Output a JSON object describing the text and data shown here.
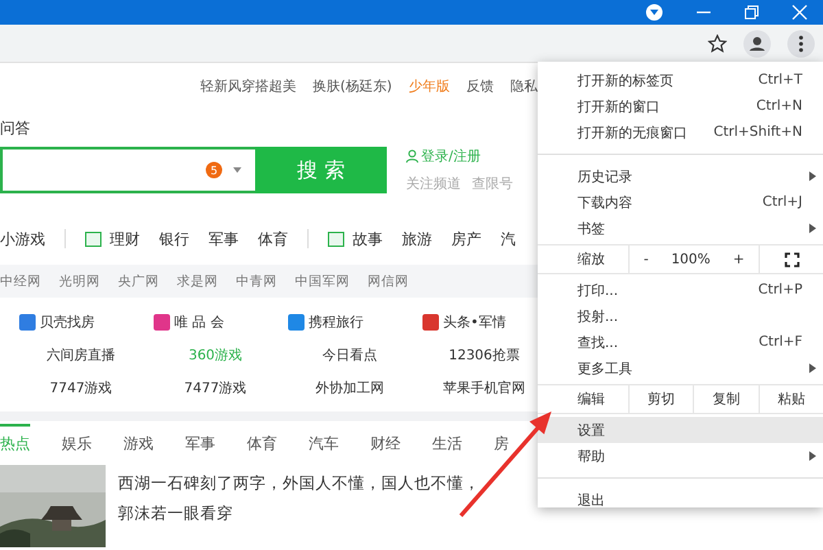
{
  "top_links": [
    {
      "label": "轻新风穿搭超美",
      "highlight": false
    },
    {
      "label": "换肤(杨廷东)",
      "highlight": false
    },
    {
      "label": "少年版",
      "highlight": true
    },
    {
      "label": "反馈",
      "highlight": false
    },
    {
      "label": "隐私",
      "highlight": false
    }
  ],
  "search": {
    "label": "问答",
    "badge": "5",
    "button": "搜 索"
  },
  "account": {
    "login": "登录/注册",
    "follow": "关注频道",
    "check": "查限号"
  },
  "nav": [
    {
      "kind": "text",
      "label": "小游戏"
    },
    {
      "kind": "divider"
    },
    {
      "kind": "icon",
      "label": "理财"
    },
    {
      "kind": "text",
      "label": "银行"
    },
    {
      "kind": "text",
      "label": "军事"
    },
    {
      "kind": "text",
      "label": "体育"
    },
    {
      "kind": "divider"
    },
    {
      "kind": "icon",
      "label": "故事"
    },
    {
      "kind": "text",
      "label": "旅游"
    },
    {
      "kind": "text",
      "label": "房产"
    },
    {
      "kind": "text",
      "label": "汽"
    }
  ],
  "media_links": [
    "中经网",
    "光明网",
    "央广网",
    "求是网",
    "中青网",
    "中国军网",
    "网信网"
  ],
  "site_grid": [
    {
      "title": "贝壳找房",
      "color": "#2f7de1",
      "links": [
        {
          "label": "六间房直播",
          "highlight": false
        },
        {
          "label": "7747游戏",
          "highlight": false
        }
      ]
    },
    {
      "title": "唯 品 会",
      "color": "#e0358a",
      "links": [
        {
          "label": "360游戏",
          "highlight": true
        },
        {
          "label": "7477游戏",
          "highlight": false
        }
      ]
    },
    {
      "title": "携程旅行",
      "color": "#1f88e5",
      "links": [
        {
          "label": "今日看点",
          "highlight": false
        },
        {
          "label": "外协加工网",
          "highlight": false
        }
      ]
    },
    {
      "title": "头条•军情",
      "color": "#d9362e",
      "links": [
        {
          "label": "12306抢票",
          "highlight": false
        },
        {
          "label": "苹果手机官网",
          "highlight": false
        }
      ]
    }
  ],
  "news_tabs": [
    {
      "label": "热点",
      "selected": true
    },
    {
      "label": "娱乐",
      "selected": false
    },
    {
      "label": "游戏",
      "selected": false
    },
    {
      "label": "军事",
      "selected": false
    },
    {
      "label": "体育",
      "selected": false
    },
    {
      "label": "汽车",
      "selected": false
    },
    {
      "label": "财经",
      "selected": false
    },
    {
      "label": "生活",
      "selected": false
    },
    {
      "label": "房",
      "selected": false
    }
  ],
  "news": [
    {
      "headline": "西湖一石碑刻了两字，外国人不懂，国人也不懂，",
      "subline": "郭沫若一眼看穿",
      "kind": "picture"
    }
  ],
  "menu": [
    {
      "kind": "item",
      "label": "打开新的标签页",
      "shortcut": "Ctrl+T",
      "submenu": false,
      "selected": false
    },
    {
      "kind": "item",
      "label": "打开新的窗口",
      "shortcut": "Ctrl+N",
      "submenu": false,
      "selected": false
    },
    {
      "kind": "item",
      "label": "打开新的无痕窗口",
      "shortcut": "Ctrl+Shift+N",
      "submenu": false,
      "selected": false
    },
    {
      "kind": "divider"
    },
    {
      "kind": "item",
      "label": "历史记录",
      "submenu": true,
      "selected": false
    },
    {
      "kind": "item",
      "label": "下载内容",
      "shortcut": "Ctrl+J",
      "submenu": false,
      "selected": false
    },
    {
      "kind": "item",
      "label": "书签",
      "submenu": true,
      "selected": false
    },
    {
      "kind": "zoom",
      "label": "缩放",
      "minus": "-",
      "value": "100%",
      "plus": "+"
    },
    {
      "kind": "item",
      "label": "打印...",
      "shortcut": "Ctrl+P",
      "submenu": false,
      "selected": false
    },
    {
      "kind": "item",
      "label": "投射...",
      "submenu": false,
      "selected": false
    },
    {
      "kind": "item",
      "label": "查找...",
      "shortcut": "Ctrl+F",
      "submenu": false,
      "selected": false
    },
    {
      "kind": "item",
      "label": "更多工具",
      "submenu": true,
      "selected": false
    },
    {
      "kind": "edit",
      "label": "编辑",
      "actions": [
        "剪切",
        "复制",
        "粘贴"
      ]
    },
    {
      "kind": "item",
      "label": "设置",
      "submenu": false,
      "selected": true
    },
    {
      "kind": "item",
      "label": "帮助",
      "submenu": true,
      "selected": false
    },
    {
      "kind": "divider"
    },
    {
      "kind": "item",
      "label": "退出",
      "submenu": false,
      "selected": false
    }
  ]
}
